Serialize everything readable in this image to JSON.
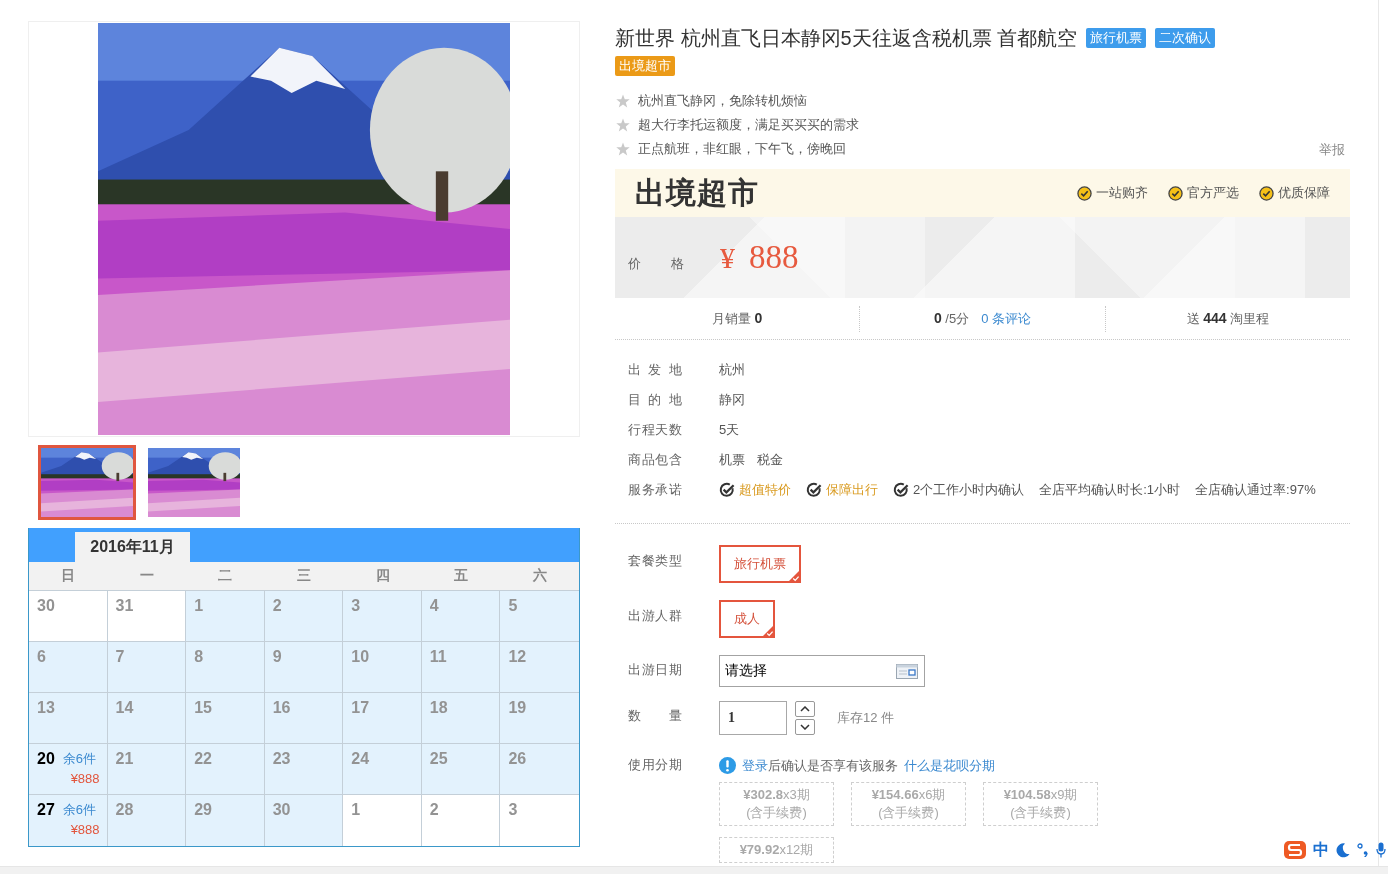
{
  "gallery": {
    "thumbnails": [
      {
        "selected": true
      },
      {
        "selected": false
      }
    ]
  },
  "calendar": {
    "month": "2016年11月",
    "weekdays": [
      "日",
      "一",
      "二",
      "三",
      "四",
      "五",
      "六"
    ],
    "weeks": [
      [
        {
          "day": "30",
          "in_month": false,
          "available": false
        },
        {
          "day": "31",
          "in_month": false,
          "available": false
        },
        {
          "day": "1",
          "in_month": true,
          "available": false
        },
        {
          "day": "2",
          "in_month": true,
          "available": false
        },
        {
          "day": "3",
          "in_month": true,
          "available": false
        },
        {
          "day": "4",
          "in_month": true,
          "available": false
        },
        {
          "day": "5",
          "in_month": true,
          "available": false
        }
      ],
      [
        {
          "day": "6",
          "in_month": true,
          "available": false
        },
        {
          "day": "7",
          "in_month": true,
          "available": false
        },
        {
          "day": "8",
          "in_month": true,
          "available": false
        },
        {
          "day": "9",
          "in_month": true,
          "available": false
        },
        {
          "day": "10",
          "in_month": true,
          "available": false
        },
        {
          "day": "11",
          "in_month": true,
          "available": false
        },
        {
          "day": "12",
          "in_month": true,
          "available": false
        }
      ],
      [
        {
          "day": "13",
          "in_month": true,
          "available": false
        },
        {
          "day": "14",
          "in_month": true,
          "available": false
        },
        {
          "day": "15",
          "in_month": true,
          "available": false
        },
        {
          "day": "16",
          "in_month": true,
          "available": false
        },
        {
          "day": "17",
          "in_month": true,
          "available": false
        },
        {
          "day": "18",
          "in_month": true,
          "available": false
        },
        {
          "day": "19",
          "in_month": true,
          "available": false
        }
      ],
      [
        {
          "day": "20",
          "in_month": true,
          "available": true,
          "stock": "余6件",
          "price": "¥888"
        },
        {
          "day": "21",
          "in_month": true,
          "available": false
        },
        {
          "day": "22",
          "in_month": true,
          "available": false
        },
        {
          "day": "23",
          "in_month": true,
          "available": false
        },
        {
          "day": "24",
          "in_month": true,
          "available": false
        },
        {
          "day": "25",
          "in_month": true,
          "available": false
        },
        {
          "day": "26",
          "in_month": true,
          "available": false
        }
      ],
      [
        {
          "day": "27",
          "in_month": true,
          "available": true,
          "stock": "余6件",
          "price": "¥888"
        },
        {
          "day": "28",
          "in_month": true,
          "available": false
        },
        {
          "day": "29",
          "in_month": true,
          "available": false
        },
        {
          "day": "30",
          "in_month": true,
          "available": false
        },
        {
          "day": "1",
          "in_month": false,
          "available": false
        },
        {
          "day": "2",
          "in_month": false,
          "available": false
        },
        {
          "day": "3",
          "in_month": false,
          "available": false
        }
      ]
    ]
  },
  "product": {
    "title": "新世界 杭州直飞日本静冈5天往返含税机票 首都航空",
    "tags": [
      {
        "text": "旅行机票",
        "color": "#3d9cec"
      },
      {
        "text": "二次确认",
        "color": "#3d9cec"
      },
      {
        "text": "出境超市",
        "color": "#eb9a17"
      }
    ],
    "highlights": [
      "杭州直飞静冈，免除转机烦恼",
      "超大行李托运额度，满足买买买的需求",
      "正点航班，非红眼，下午飞，傍晚回"
    ],
    "report_link": "举报"
  },
  "banner": {
    "logo": "出境超市",
    "badges": [
      "一站购齐",
      "官方严选",
      "优质保障"
    ]
  },
  "price": {
    "label": "价 格",
    "currency": "¥",
    "amount": "888"
  },
  "stats": {
    "sales": "月销量 **0**",
    "rating": "**0** /5分",
    "reviews_link": "0 条评论",
    "points": "送 **444** 淘里程"
  },
  "details": [
    {
      "label": "出 发 地",
      "values": [
        "杭州"
      ]
    },
    {
      "label": "目 的 地",
      "values": [
        "静冈"
      ]
    },
    {
      "label": "行程天数",
      "values": [
        "5天"
      ]
    },
    {
      "label": "商品包含",
      "values": [
        "机票",
        "税金"
      ]
    }
  ],
  "services": {
    "label": "服务承诺",
    "items": [
      {
        "kind": "promo",
        "text": "超值特价"
      },
      {
        "kind": "promo",
        "text": "保障出行"
      },
      {
        "kind": "check",
        "text": "2个工作小时内确认"
      },
      {
        "kind": "note",
        "text": "全店平均确认时长:1小时"
      },
      {
        "kind": "note",
        "text": "全店确认通过率:97%"
      }
    ]
  },
  "options": [
    {
      "label": "套餐类型",
      "choices": [
        {
          "text": "旅行机票",
          "selected": true
        }
      ]
    },
    {
      "label": "出游人群",
      "choices": [
        {
          "text": "成人",
          "selected": true
        }
      ]
    }
  ],
  "date": {
    "label": "出游日期",
    "value": "请选择"
  },
  "quantity": {
    "label": "数 量",
    "value": "1",
    "stock": "库存12 件"
  },
  "installment": {
    "label": "使用分期",
    "login_link": "登录",
    "notice": "后确认是否享有该服务",
    "help_link": "什么是花呗分期",
    "plans": [
      {
        "text": "**¥302.8**x3期",
        "fee": "(含手续费)",
        "disabled": true
      },
      {
        "text": "**¥154.66**x6期",
        "fee": "(含手续费)",
        "disabled": true
      },
      {
        "text": "**¥104.58**x9期",
        "fee": "(含手续费)",
        "disabled": true
      },
      {
        "text": "**¥79.92**x12期",
        "disabled": true
      }
    ]
  },
  "ime": {
    "mode": "中"
  }
}
